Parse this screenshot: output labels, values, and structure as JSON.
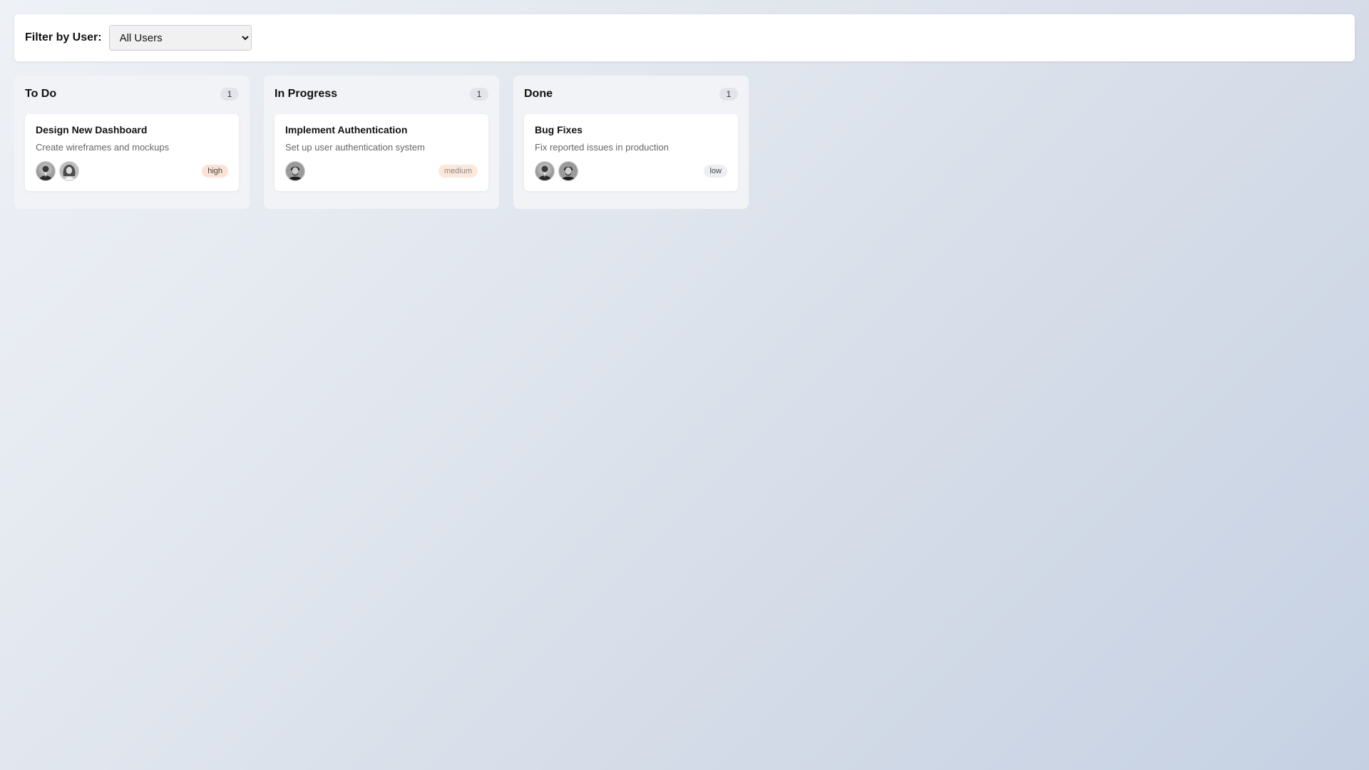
{
  "filter": {
    "label": "Filter by User:",
    "selected": "All Users",
    "options": [
      "All Users"
    ]
  },
  "columns": [
    {
      "title": "To Do",
      "count": "1",
      "card": {
        "title": "Design New Dashboard",
        "description": "Create wireframes and mockups",
        "priority": "high",
        "avatars": [
          "user-avatar-1",
          "user-avatar-2"
        ]
      }
    },
    {
      "title": "In Progress",
      "count": "1",
      "card": {
        "title": "Implement Authentication",
        "description": "Set up user authentication system",
        "priority": "medium",
        "avatars": [
          "user-avatar-3"
        ]
      }
    },
    {
      "title": "Done",
      "count": "1",
      "card": {
        "title": "Bug Fixes",
        "description": "Fix reported issues in production",
        "priority": "low",
        "avatars": [
          "user-avatar-1",
          "user-avatar-3"
        ]
      }
    }
  ],
  "colors": {
    "badge_high": "#fce3d5",
    "badge_medium": "#fce8db",
    "badge_low": "#eceef2"
  }
}
